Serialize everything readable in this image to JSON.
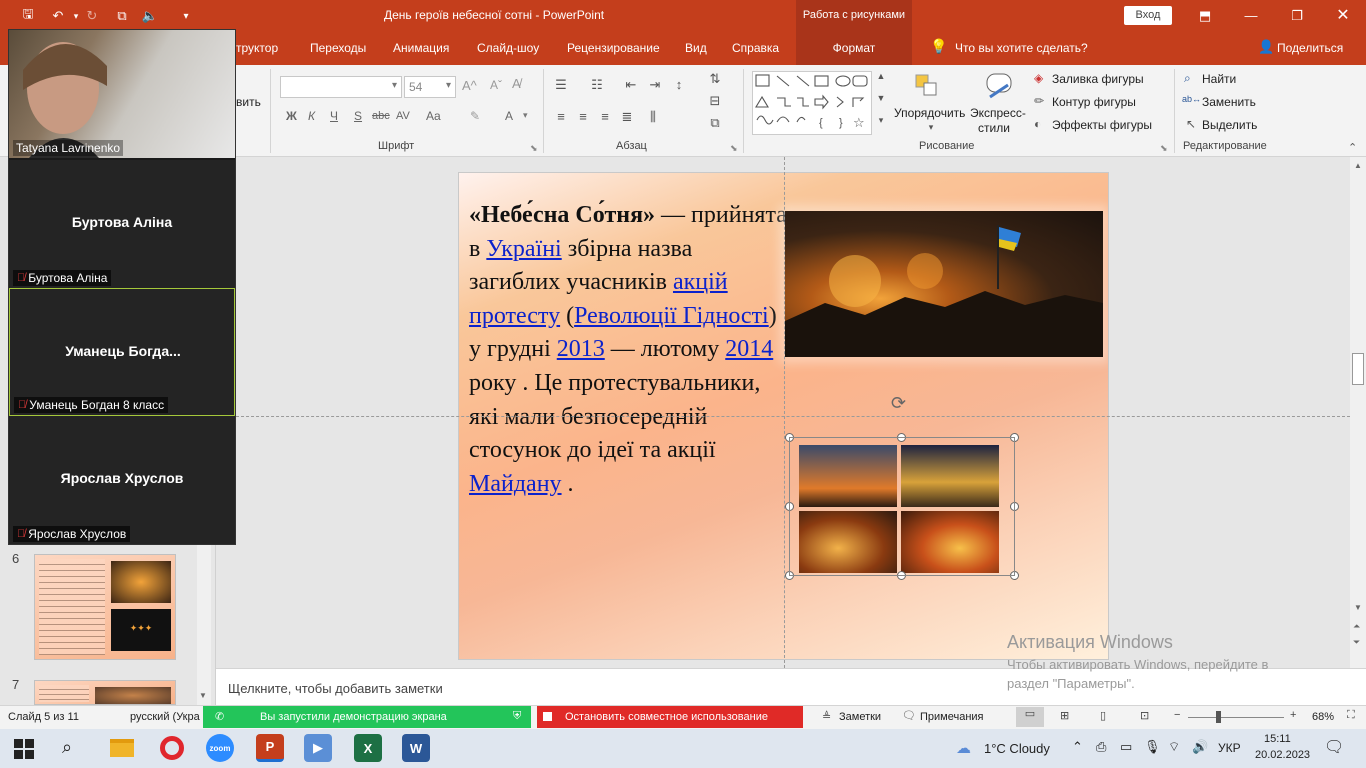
{
  "titlebar": {
    "title": "День героїв небесної сотні  -  PowerPoint",
    "context_group": "Работа с рисунками",
    "signin": "Вход",
    "qa_icons": [
      "save-icon",
      "undo-icon",
      "redo-icon",
      "presenter-icon",
      "speaker-icon",
      "customize-icon"
    ]
  },
  "tabs": {
    "items": [
      "труктор",
      "Переходы",
      "Анимация",
      "Слайд-шоу",
      "Рецензирование",
      "Вид",
      "Справка"
    ],
    "format": "Формат",
    "tell_me": "Что вы хотите сделать?",
    "share": "Поделиться"
  },
  "ribbon": {
    "clip_fragment": "вить",
    "font_size": "54",
    "font_group": "Шрифт",
    "para_group": "Абзац",
    "draw_group": "Рисование",
    "edit_group": "Редактирование",
    "arrange": "Упорядочить",
    "quick_styles_1": "Экспресс-",
    "quick_styles_2": "стили",
    "fill": "Заливка фигуры",
    "outline": "Контур фигуры",
    "effects": "Эффекты фигуры",
    "find": "Найти",
    "replace": "Заменить",
    "select": "Выделить",
    "font_buttons": [
      "Ж",
      "К",
      "Ч",
      "S",
      "abc",
      "AV",
      "Aa"
    ]
  },
  "slide": {
    "text": [
      {
        "t": "«Небе́сна Со́тня»",
        "b": true
      },
      {
        "t": " — прийнята в "
      },
      {
        "t": "Україні",
        "link": true
      },
      {
        "t": " збірна назва загиблих учасників "
      },
      {
        "t": "акцій протесту",
        "link": true
      },
      {
        "t": " ("
      },
      {
        "t": "Революції Гідності",
        "link": true
      },
      {
        "t": ") у грудні "
      },
      {
        "t": "2013",
        "link": true
      },
      {
        "t": " — лютому "
      },
      {
        "t": "2014",
        "link": true
      },
      {
        "t": " року . Це протестувальники, які мали безпосередній стосунок до ідеї та акції "
      },
      {
        "t": "Майдану",
        "link": true
      },
      {
        "t": " ."
      }
    ]
  },
  "thumbs": [
    {
      "num": "6"
    },
    {
      "num": "7"
    }
  ],
  "notes_placeholder": "Щелкните, чтобы добавить заметки",
  "watermark": {
    "title": "Активация Windows",
    "line1": "Чтобы активировать Windows, перейдите в",
    "line2": "раздел \"Параметры\"."
  },
  "status": {
    "slide": "Слайд 5 из 11",
    "lang": "русский (Укра",
    "share_msg": "Вы запустили демонстрацию экрана",
    "stop_share": "Остановить совместное использование",
    "notes": "Заметки",
    "comments": "Примечания",
    "zoom": "68%"
  },
  "zoom_panel": {
    "self_name": "Tatyana Lavrinenko",
    "participants": [
      {
        "display": "Буртова Аліна",
        "label": "Буртова Аліна",
        "active": false
      },
      {
        "display": "Уманець  Богда...",
        "label": "Уманець Богдан 8 класс",
        "active": true
      },
      {
        "display": "Ярослав Хруслов",
        "label": "Ярослав Хруслов",
        "active": false
      }
    ]
  },
  "taskbar": {
    "weather": "1°C  Cloudy",
    "lang": "УКР",
    "time": "15:11",
    "date": "20.02.2023",
    "apps": [
      {
        "name": "file-explorer",
        "label": "",
        "color": "#f0b429"
      },
      {
        "name": "opera",
        "label": "O",
        "color": "#e0262d"
      },
      {
        "name": "zoom",
        "label": "zoom",
        "color": "#2d8cff"
      },
      {
        "name": "powerpoint",
        "label": "P",
        "color": "#c43e1c"
      },
      {
        "name": "media-player",
        "label": "▶",
        "color": "#5b8fd6"
      },
      {
        "name": "excel",
        "label": "X",
        "color": "#1d7044"
      },
      {
        "name": "word",
        "label": "W",
        "color": "#2b5797"
      }
    ]
  }
}
